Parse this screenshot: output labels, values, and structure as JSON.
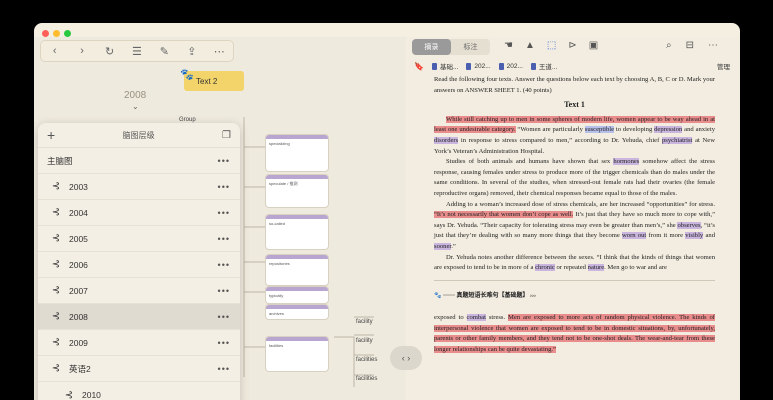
{
  "toolbar": {
    "back": "‹",
    "forward": "›"
  },
  "map": {
    "year_label": "2008",
    "text_node": "Text 2",
    "group_label": "Group",
    "nodes": [
      "specializing",
      "speculate / 推测",
      "so-called",
      "repositories",
      "typically",
      "archives",
      "facility",
      "facility",
      "facilities"
    ],
    "small": [
      "facility",
      "facility",
      "facility",
      "facilities",
      "facilities"
    ]
  },
  "panel": {
    "title": "脑图层级",
    "root": "主脑图",
    "years": [
      "2003",
      "2004",
      "2005",
      "2006",
      "2007",
      "2008",
      "2009"
    ],
    "english": "英语2",
    "sub": "2010",
    "more": "•••"
  },
  "right": {
    "tab_excerpt": "摘录",
    "tab_annotate": "标注",
    "manage": "管理",
    "tabs": [
      "基础...",
      "202...",
      "202...",
      "王道..."
    ]
  },
  "doc": {
    "instr": "Read the following four texts. Answer the questions below each text by choosing A, B, C or D. Mark your answers on ANSWER SHEET 1. (40 points)",
    "heading": "Text 1",
    "p1a": "While still catching up to men in some spheres of modern life, women appear to be way ahead in at least one undesirable category.",
    "p1b": " “Women are particularly ",
    "p1c": "susceptible",
    "p1d": " to developing ",
    "p1e": "depression",
    "p1f": " and anxiety ",
    "p1g": "disorders",
    "p1h": " in response to stress compared to men,” according to Dr. Yehuda, chief ",
    "p1i": "psychiatrist",
    "p1j": " at New York’s Veteran’s Administration Hospital.",
    "p2a": "Studies of both animals and humans have shown that sex ",
    "p2b": "hormones",
    "p2c": " somehow affect the stress response, causing females under stress to produce more of the trigger chemicals than do males under the same conditions. In several of the studies, when stressed-out female rats had their ovaries (the female reproductive organs) removed, their chemical responses became equal to those of the males.",
    "p3a": "Adding to a woman’s increased dose of stress chemicals, are her increased “opportunities” for stress. ",
    "p3b": "“It’s not necessarily that women don’t cope as well.",
    "p3c": " It’s just that they have so much more to cope with,” says Dr. Yehuda. “Their capacity for tolerating stress may even be greater than men’s,” she ",
    "p3d": "observes",
    "p3e": ", “it’s just that they’re dealing with so many more things that they become ",
    "p3f": "worn out",
    "p3g": " from it more ",
    "p3h": "visibly",
    "p3i": " and ",
    "p3j": "sooner",
    "p3k": ".”",
    "p4a": "Dr. Yehuda notes another difference between the sexes. “I think that the kinds of things that women are exposed to tend to be in more of a ",
    "p4b": "chronic",
    "p4c": " or repeated ",
    "p4d": "nature",
    "p4e": ". Men go to war and are",
    "sec": "······ 真题短语长难句【基础题】 ›››",
    "p5a": "exposed to ",
    "p5b": "combat",
    "p5c": " stress. ",
    "p5d": "Men are exposed to more acts of random physical violence. The kinds of interpersonal violence that women are exposed to tend to be in domestic situations, by, unfortunately, parents or other family members, and they tend not to be one-shot deals. The wear-and-tear from these longer relationships can be quite devastating.”"
  },
  "colors": {
    "highlight_red": "#e88c8c",
    "highlight_purple": "#c9b5de",
    "highlight_blue": "#b7c0ea",
    "accent": "#3a67d8"
  }
}
